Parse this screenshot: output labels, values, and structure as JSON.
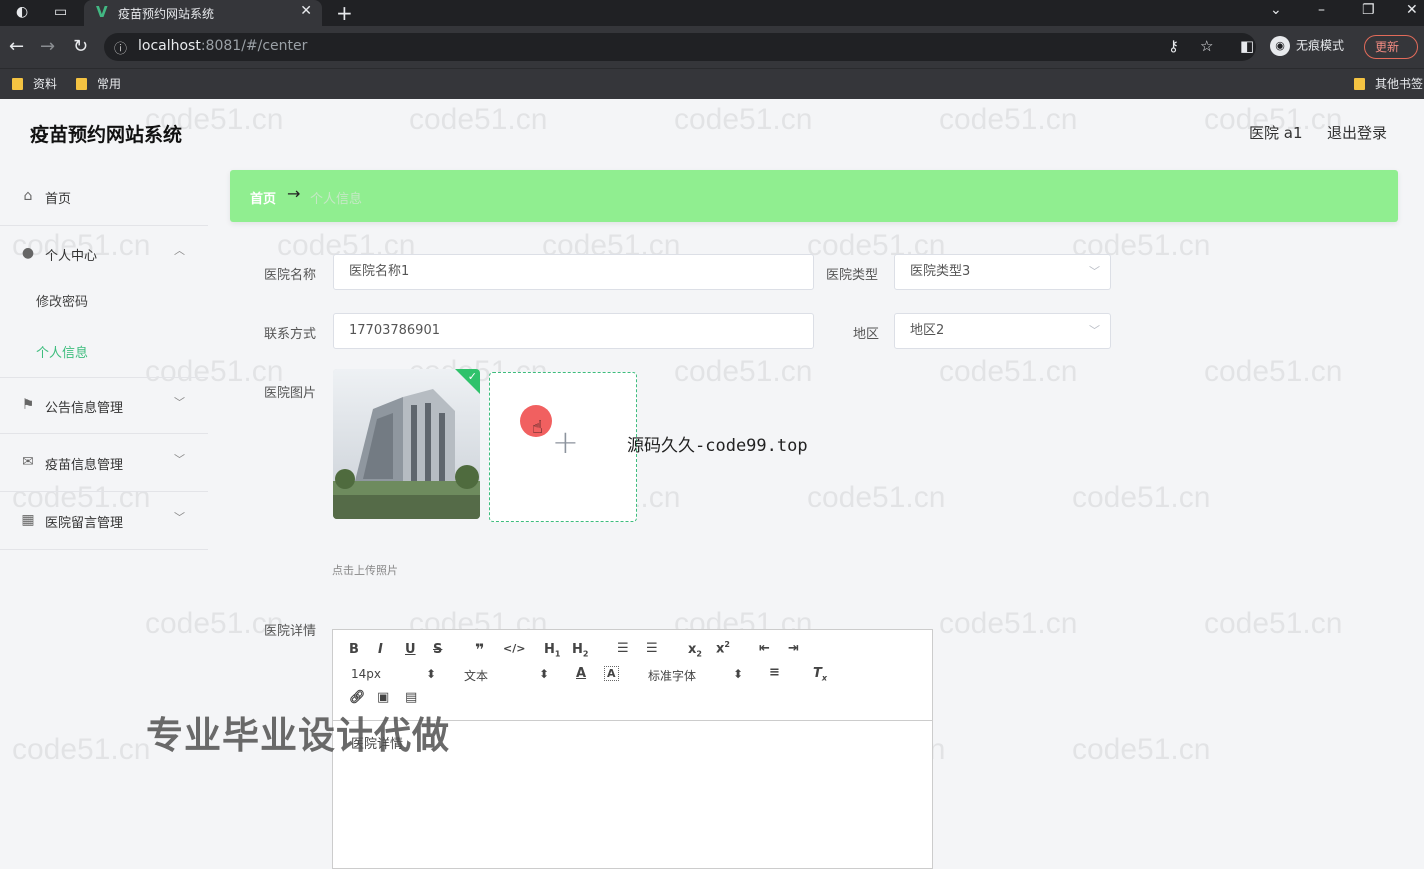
{
  "browser": {
    "tab_title": "疫苗预约网站系统",
    "tab_close": "✕",
    "new_tab": "+",
    "url_host": "localhost",
    "url_path": ":8081/#/center",
    "incognito_label": "无痕模式",
    "update_label": "更新",
    "bookmarks": [
      "资料",
      "常用"
    ],
    "other_bookmarks": "其他书签"
  },
  "header": {
    "app_title": "疫苗预约网站系统",
    "user_name": "医院 a1",
    "logout": "退出登录"
  },
  "sidebar": {
    "items": [
      {
        "label": "首页",
        "icon": "home-icon"
      },
      {
        "label": "个人中心",
        "icon": "user-icon"
      },
      {
        "label": "公告信息管理",
        "icon": "flag-icon"
      },
      {
        "label": "疫苗信息管理",
        "icon": "mail-icon"
      },
      {
        "label": "医院留言管理",
        "icon": "grid-icon"
      }
    ],
    "sub_items": [
      {
        "label": "修改密码"
      },
      {
        "label": "个人信息"
      }
    ]
  },
  "breadcrumb": {
    "home": "首页",
    "arrow": "→",
    "current": "个人信息"
  },
  "form": {
    "hospital_name_label": "医院名称",
    "hospital_name_value": "医院名称1",
    "hospital_type_label": "医院类型",
    "hospital_type_value": "医院类型3",
    "contact_label": "联系方式",
    "contact_value": "17703786901",
    "region_label": "地区",
    "region_value": "地区2",
    "photo_label": "医院图片",
    "upload_hint": "点击上传照片",
    "detail_label": "医院详情",
    "detail_placeholder": "医院详情"
  },
  "editor": {
    "font_size": "14px",
    "text_style": "文本",
    "font_family": "标准字体"
  },
  "overlays": {
    "source_site": "源码久久-code99.top",
    "ad_text": "专业毕业设计代做",
    "watermark": "code51.cn"
  },
  "colors": {
    "breadcrumb_bg": "#90ee90",
    "accent": "#3dbd7d",
    "check": "#2fc26b"
  }
}
